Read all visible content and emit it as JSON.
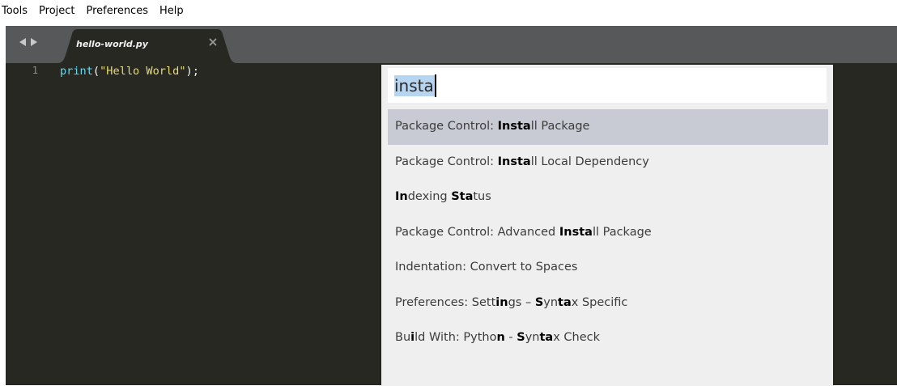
{
  "menubar": {
    "items": [
      "Tools",
      "Project",
      "Preferences",
      "Help"
    ]
  },
  "tabbar": {
    "nav_icons": [
      "left-arrow-icon",
      "right-arrow-icon"
    ],
    "tabs": [
      {
        "label": "hello-world.py",
        "active": true,
        "close_icon": "close-icon"
      }
    ]
  },
  "editor": {
    "line_numbers": [
      "1"
    ],
    "lines": [
      {
        "tokens": [
          {
            "text": "print",
            "kind": "fn"
          },
          {
            "text": "(",
            "kind": "punct"
          },
          {
            "text": "\"Hello World\"",
            "kind": "str"
          },
          {
            "text": ");",
            "kind": "punct"
          }
        ]
      }
    ]
  },
  "command_palette": {
    "query": "insta",
    "items": [
      {
        "segments": [
          {
            "t": "Package Control: ",
            "b": false
          },
          {
            "t": "Insta",
            "b": true
          },
          {
            "t": "ll Package",
            "b": false
          }
        ],
        "selected": true
      },
      {
        "segments": [
          {
            "t": "Package Control: ",
            "b": false
          },
          {
            "t": "Insta",
            "b": true
          },
          {
            "t": "ll Local Dependency",
            "b": false
          }
        ],
        "selected": false
      },
      {
        "segments": [
          {
            "t": "In",
            "b": true
          },
          {
            "t": "dexing ",
            "b": false
          },
          {
            "t": "Sta",
            "b": true
          },
          {
            "t": "tus",
            "b": false
          }
        ],
        "selected": false
      },
      {
        "segments": [
          {
            "t": "Package Control: Advanced ",
            "b": false
          },
          {
            "t": "Insta",
            "b": true
          },
          {
            "t": "ll Package",
            "b": false
          }
        ],
        "selected": false
      },
      {
        "segments": [
          {
            "t": "Indentation: Convert to Spaces",
            "b": false
          }
        ],
        "selected": false
      },
      {
        "segments": [
          {
            "t": "Preferences: Sett",
            "b": false
          },
          {
            "t": "in",
            "b": true
          },
          {
            "t": "gs – ",
            "b": false
          },
          {
            "t": "S",
            "b": true
          },
          {
            "t": "yn",
            "b": false
          },
          {
            "t": "ta",
            "b": true
          },
          {
            "t": "x Specific",
            "b": false
          }
        ],
        "selected": false
      },
      {
        "segments": [
          {
            "t": "Bu",
            "b": false
          },
          {
            "t": "i",
            "b": true
          },
          {
            "t": "ld With: Pytho",
            "b": false
          },
          {
            "t": "n",
            "b": true
          },
          {
            "t": " - ",
            "b": false
          },
          {
            "t": "S",
            "b": true
          },
          {
            "t": "yn",
            "b": false
          },
          {
            "t": "ta",
            "b": true
          },
          {
            "t": "x Check",
            "b": false
          }
        ],
        "selected": false
      }
    ]
  },
  "colors": {
    "editor_bg": "#272822",
    "tabbar_bg": "#57585a",
    "active_tab_bg": "#272822",
    "palette_bg": "#efefef",
    "palette_selected_bg": "#c8cbd3",
    "input_selection": "#b5d5f0",
    "code_function": "#66d9ef",
    "code_string": "#e6db74"
  }
}
